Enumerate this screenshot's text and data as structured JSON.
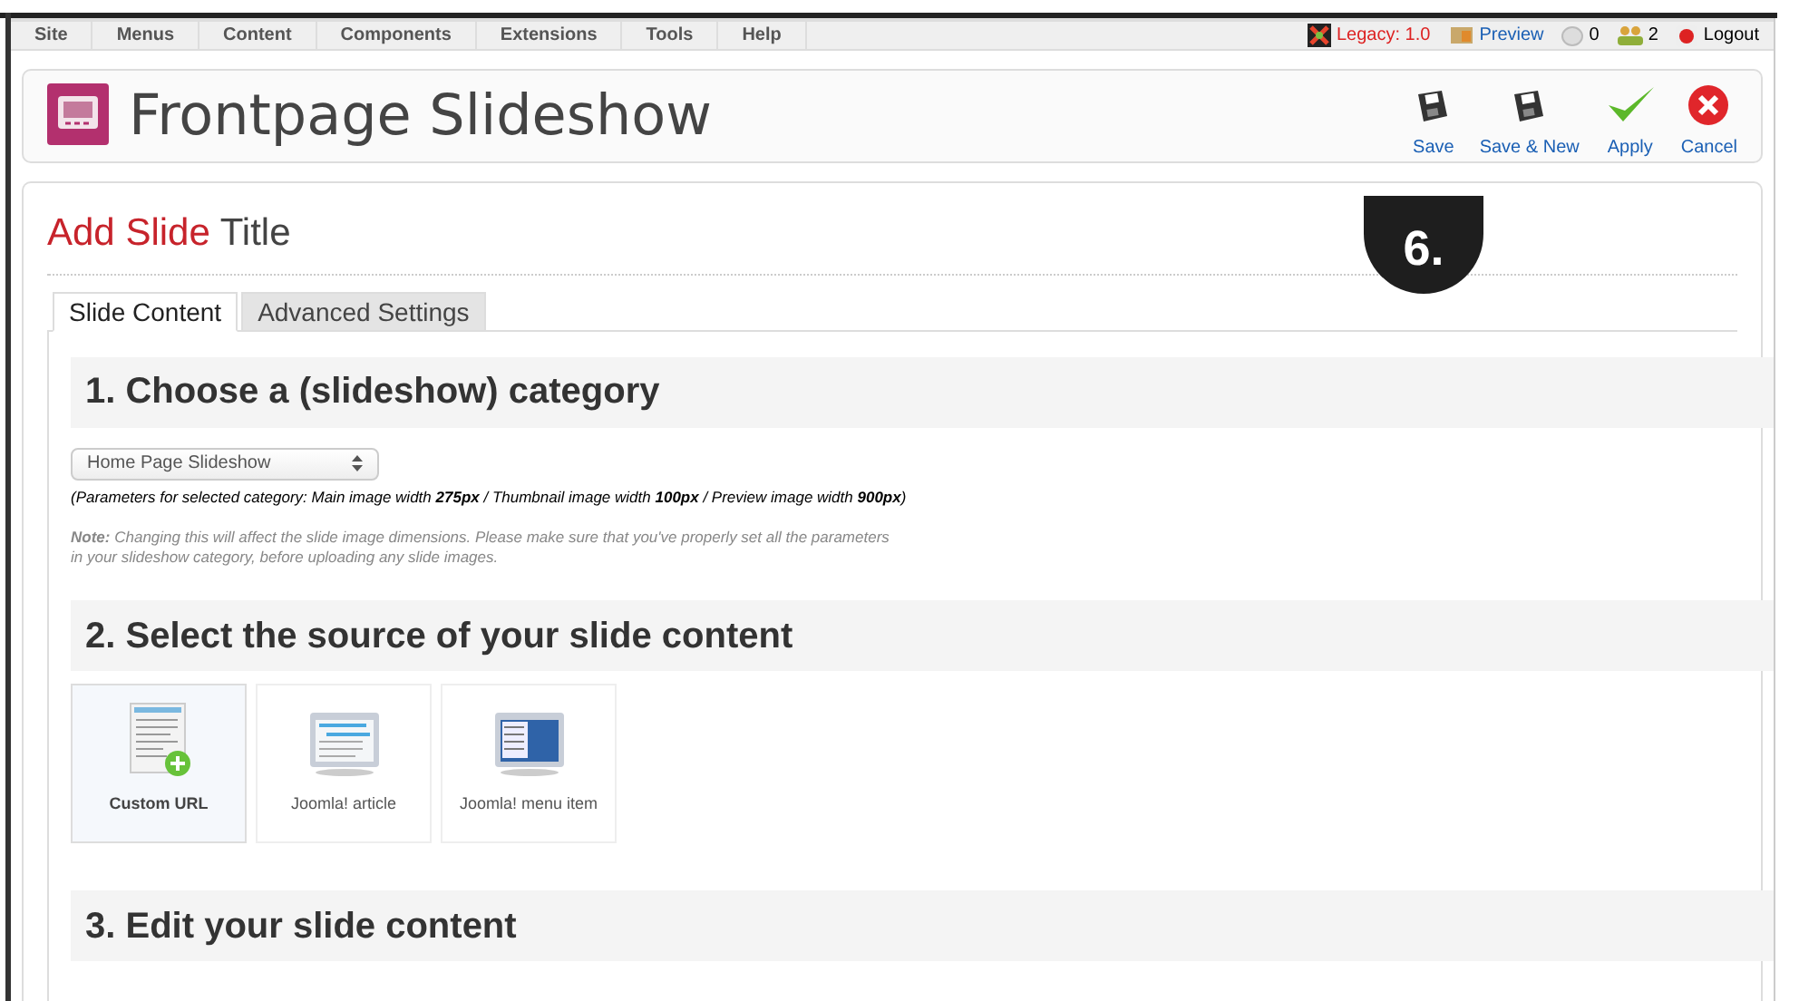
{
  "menu_bar": {
    "items": [
      "Site",
      "Menus",
      "Content",
      "Components",
      "Extensions",
      "Tools",
      "Help"
    ],
    "status": [
      {
        "kind": "legacy",
        "label": "Legacy: 1.0"
      },
      {
        "kind": "preview",
        "label": "Preview"
      },
      {
        "kind": "messages",
        "label": "0"
      },
      {
        "kind": "users",
        "label": "2"
      },
      {
        "kind": "logout",
        "label": "Logout"
      }
    ]
  },
  "header": {
    "title": "Frontpage Slideshow",
    "toolbar": [
      {
        "kind": "save",
        "label": "Save"
      },
      {
        "kind": "save",
        "label": "Save & New"
      },
      {
        "kind": "apply",
        "label": "Apply"
      },
      {
        "kind": "cancel",
        "label": "Cancel"
      }
    ]
  },
  "step_badge": "6.",
  "page": {
    "title_accent": "Add Slide",
    "title_rest": "Title",
    "tabs": [
      {
        "label": "Slide Content",
        "selected": true
      },
      {
        "label": "Advanced Settings",
        "selected": false
      }
    ],
    "sections": [
      {
        "heading": "1. Choose a (slideshow) category",
        "category_select": "Home Page Slideshow",
        "parameters": "(Parameters for selected category: Main image width **275px** / Thumbnail image width **100px** / Preview image width **900px**)",
        "note": "**Note:** Changing this will affect the slide image dimensions. Please make sure that you've properly set all the parameters in your slideshow category, before uploading any slide images."
      },
      {
        "heading": "2. Select the source of your slide content",
        "sources": [
          {
            "kind": "custom",
            "label": "Custom URL",
            "selected": true
          },
          {
            "kind": "article",
            "label": "Joomla! article",
            "selected": false
          },
          {
            "kind": "menu",
            "label": "Joomla! menu item",
            "selected": false
          }
        ]
      },
      {
        "heading": "3. Edit your slide content"
      }
    ]
  }
}
